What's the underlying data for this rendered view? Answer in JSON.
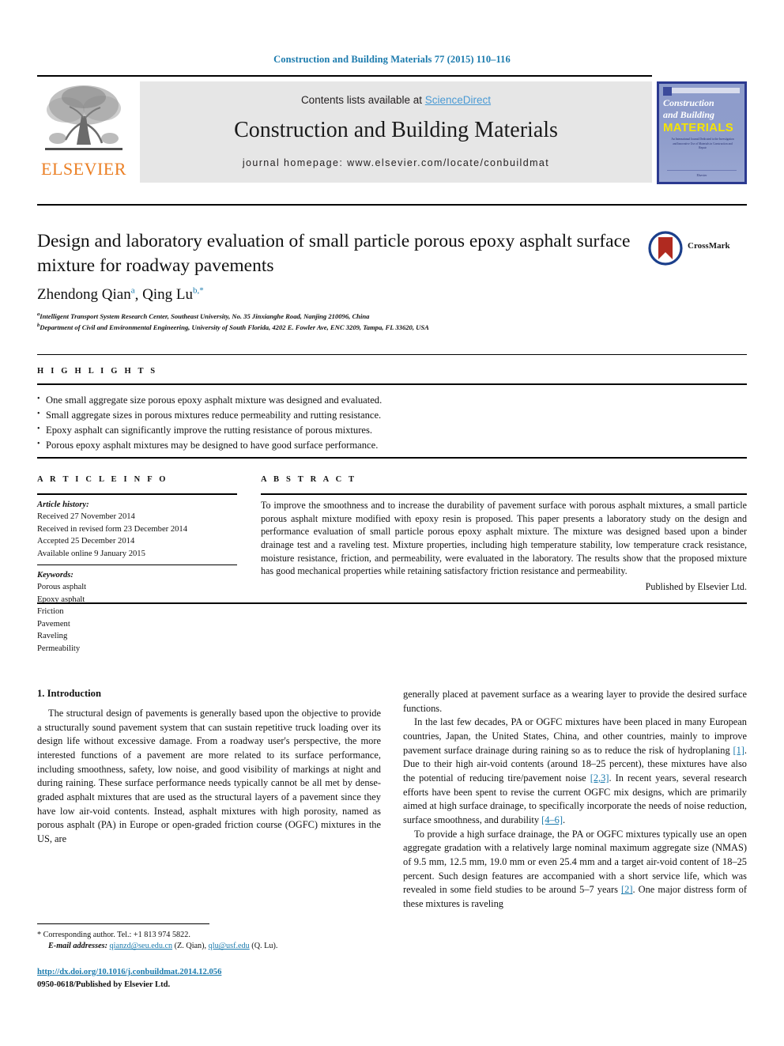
{
  "running_head": "Construction and Building Materials 77 (2015) 110–116",
  "masthead": {
    "contents_prefix": "Contents lists available at ",
    "sciencedirect": "ScienceDirect",
    "journal_title": "Construction and Building Materials",
    "homepage": "journal homepage: www.elsevier.com/locate/conbuildmat",
    "publisher_wordmark": "ELSEVIER",
    "publisher_icon": "elsevier-tree-logo",
    "cover": {
      "line1": "Construction",
      "line2": "and Building",
      "line3": "MATERIALS",
      "blurb": "An International Journal Dedicated to the Investigation and Innovative Use of Materials in Construction and Repair",
      "footer": "Elsevier"
    },
    "colors": {
      "link_blue": "#4a9ad4",
      "elsevier_orange": "#eb7f24",
      "cover_blue": "#8d9ccb",
      "cover_yellow": "#f6e500",
      "panel_grey": "#e6e6e6"
    }
  },
  "article": {
    "title": "Design and laboratory evaluation of small particle porous epoxy asphalt surface mixture for roadway pavements",
    "crossmark_label": "CrossMark",
    "authors_html": "Zhendong Qian <sup>a</sup>, Qing Lu <sup>b,</sup><sup>*</sup>",
    "authors_plain": "Zhendong Qian a, Qing Lu b,*",
    "affiliations": [
      "Intelligent Transport System Research Center, Southeast University, No. 35 Jinxianghe Road, Nanjing 210096, China",
      "Department of Civil and Environmental Engineering, University of South Florida, 4202 E. Fowler Ave, ENC 3209, Tampa, FL 33620, USA"
    ],
    "affiliation_marks": [
      "a",
      "b"
    ]
  },
  "highlights": {
    "heading": "H I G H L I G H T S",
    "items": [
      "One small aggregate size porous epoxy asphalt mixture was designed and evaluated.",
      "Small aggregate sizes in porous mixtures reduce permeability and rutting resistance.",
      "Epoxy asphalt can significantly improve the rutting resistance of porous mixtures.",
      "Porous epoxy asphalt mixtures may be designed to have good surface performance."
    ]
  },
  "article_info": {
    "heading": "A R T I C L E   I N F O",
    "history_label": "Article history:",
    "history": [
      "Received 27 November 2014",
      "Received in revised form 23 December 2014",
      "Accepted 25 December 2014",
      "Available online 9 January 2015"
    ],
    "keywords_label": "Keywords:",
    "keywords": [
      "Porous asphalt",
      "Epoxy asphalt",
      "Friction",
      "Pavement",
      "Raveling",
      "Permeability"
    ]
  },
  "abstract": {
    "heading": "A B S T R A C T",
    "text": "To improve the smoothness and to increase the durability of pavement surface with porous asphalt mixtures, a small particle porous asphalt mixture modified with epoxy resin is proposed. This paper presents a laboratory study on the design and performance evaluation of small particle porous epoxy asphalt mixture. The mixture was designed based upon a binder drainage test and a raveling test. Mixture properties, including high temperature stability, low temperature crack resistance, moisture resistance, friction, and permeability, were evaluated in the laboratory. The results show that the proposed mixture has good mechanical properties while retaining satisfactory friction resistance and permeability.",
    "published_by": "Published by Elsevier Ltd."
  },
  "body": {
    "section_heading": "1. Introduction",
    "left_p1": "The structural design of pavements is generally based upon the objective to provide a structurally sound pavement system that can sustain repetitive truck loading over its design life without excessive damage. From a roadway user's perspective, the more interested functions of a pavement are more related to its surface performance, including smoothness, safety, low noise, and good visibility of markings at night and during raining. These surface performance needs typically cannot be all met by dense-graded asphalt mixtures that are used as the structural layers of a pavement since they have low air-void contents. Instead, asphalt mixtures with high porosity, named as porous asphalt (PA) in Europe or open-graded friction course (OGFC) mixtures in the US, are",
    "right_p1_cont": "generally placed at pavement surface as a wearing layer to provide the desired surface functions.",
    "right_p2_a": "In the last few decades, PA or OGFC mixtures have been placed in many European countries, Japan, the United States, China, and other countries, mainly to improve pavement surface drainage during raining so as to reduce the risk of hydroplaning ",
    "right_p2_ref1": "[1]",
    "right_p2_b": ". Due to their high air-void contents (around 18–25 percent), these mixtures have also the potential of reducing tire/pavement noise ",
    "right_p2_ref2": "[2,3]",
    "right_p2_c": ". In recent years, several research efforts have been spent to revise the current OGFC mix designs, which are primarily aimed at high surface drainage, to specifically incorporate the needs of noise reduction, surface smoothness, and durability ",
    "right_p2_ref3": "[4–6]",
    "right_p2_d": ".",
    "right_p3_a": "To provide a high surface drainage, the PA or OGFC mixtures typically use an open aggregate gradation with a relatively large nominal maximum aggregate size (NMAS) of 9.5 mm, 12.5 mm, 19.0 mm or even 25.4 mm and a target air-void content of 18–25 percent. Such design features are accompanied with a short service life, which was revealed in some field studies to be around 5–7 years ",
    "right_p3_ref": "[2]",
    "right_p3_b": ". One major distress form of these mixtures is raveling"
  },
  "footer": {
    "corresponding_mark": "*",
    "corresponding_text": "Corresponding author. Tel.: +1 813 974 5822.",
    "email_label": "E-mail addresses:",
    "email1": "qianzd@seu.edu.cn",
    "email1_who": "(Z. Qian)",
    "email2": "qlu@usf.edu",
    "email2_who": "(Q. Lu)",
    "doi": "http://dx.doi.org/10.1016/j.conbuildmat.2014.12.056",
    "issn_line": "0950-0618/Published by Elsevier Ltd."
  }
}
